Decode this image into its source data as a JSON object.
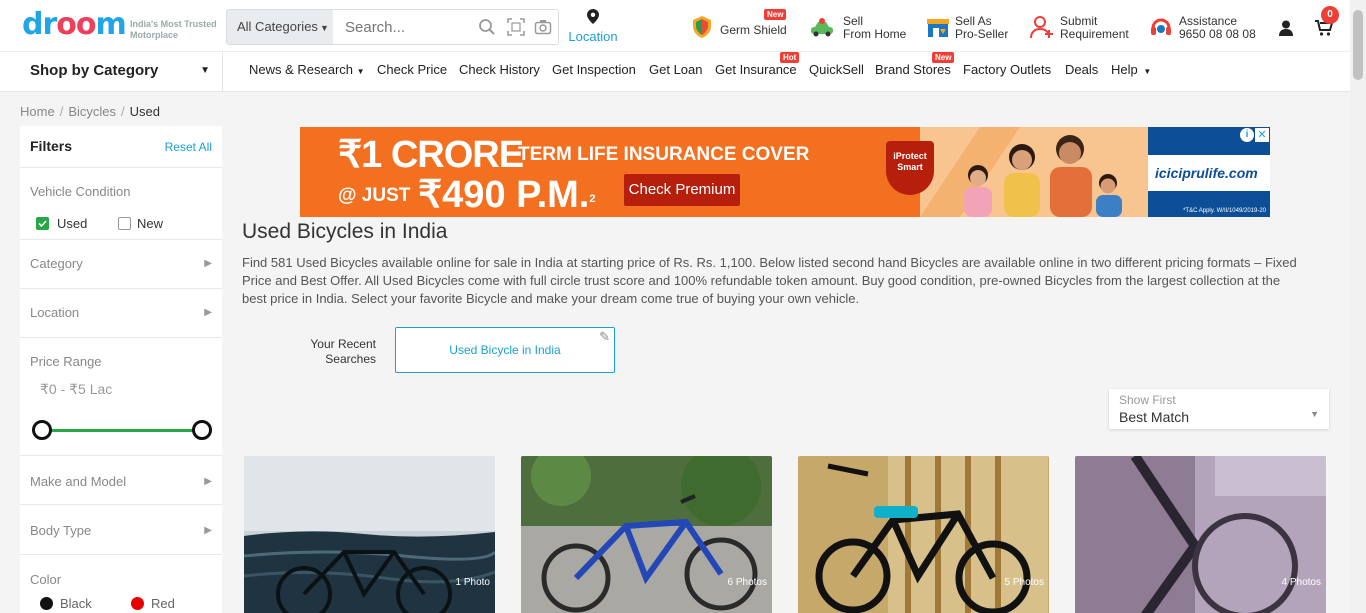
{
  "header": {
    "logo": {
      "p1": "dr",
      "p2": "oo",
      "p3": "m"
    },
    "tagline": [
      "India's Most Trusted",
      "Motorplace"
    ],
    "category_select": "All Categories",
    "search_placeholder": "Search...",
    "location_label": "Location",
    "quick_links": [
      {
        "l1": "Germ Shield",
        "l2": "",
        "badge": "New"
      },
      {
        "l1": "Sell",
        "l2": "From Home",
        "badge": ""
      },
      {
        "l1": "Sell As",
        "l2": "Pro-Seller",
        "badge": ""
      },
      {
        "l1": "Submit",
        "l2": "Requirement",
        "badge": ""
      },
      {
        "l1": "Assistance",
        "l2": "9650 08 08 08",
        "badge": ""
      }
    ],
    "cart_count": "0"
  },
  "nav": {
    "shop_by_category": "Shop by Category",
    "links": [
      {
        "label": "News & Research",
        "badge": ""
      },
      {
        "label": "Check Price",
        "badge": ""
      },
      {
        "label": "Check History",
        "badge": ""
      },
      {
        "label": "Get Inspection",
        "badge": ""
      },
      {
        "label": "Get Loan",
        "badge": ""
      },
      {
        "label": "Get Insurance",
        "badge": "Hot"
      },
      {
        "label": "QuickSell",
        "badge": ""
      },
      {
        "label": "Brand Stores",
        "badge": "New"
      },
      {
        "label": "Factory Outlets",
        "badge": ""
      },
      {
        "label": "Deals",
        "badge": ""
      },
      {
        "label": "Help",
        "badge": ""
      }
    ]
  },
  "breadcrumb": [
    "Home",
    "Bicycles",
    "Used"
  ],
  "filters": {
    "title": "Filters",
    "reset": "Reset All",
    "vehicle_condition": "Vehicle Condition",
    "used": "Used",
    "new": "New",
    "category": "Category",
    "location": "Location",
    "price_range": "Price Range",
    "price_value": "₹0 - ₹5 Lac",
    "price_min_fraction": 0,
    "price_max_fraction": 1,
    "make_model": "Make and Model",
    "body_type": "Body Type",
    "color": "Color",
    "colors": [
      {
        "name": "Black",
        "hex": "#111111"
      },
      {
        "name": "Red",
        "hex": "#e60000"
      }
    ]
  },
  "ad": {
    "line1": "₹1 CRORE",
    "line1_suffix": "TERM LIFE INSURANCE COVER",
    "line2_prefix": "@ JUST",
    "line2": "₹490 P.M.",
    "superscript": "2",
    "cta": "Check Premium",
    "shield": "iProtect Smart",
    "url": "iciciprulife.com",
    "tnc": "*T&C Apply. W/II/1049/2019-20"
  },
  "main": {
    "title": "Used Bicycles in India",
    "description": "Find 581 Used Bicycles available online for sale in India at starting price of Rs. Rs. 1,100. Below listed second hand Bicycles are available online in two different pricing formats – Fixed Price and Best Offer. All Used Bicycles come with full circle trust score and 100% refundable token amount. Buy good condition, pre-owned Bicycles from the largest collection at the best price in India. Select your favorite Bicycle and make your dream come true of buying your own vehicle.",
    "recent_label_1": "Your Recent",
    "recent_label_2": "Searches",
    "recent_search": "Used Bicycle in India",
    "sort_label": "Show First",
    "sort_value": "Best Match",
    "cards": [
      {
        "photos": "1 Photo"
      },
      {
        "photos": "6 Photos"
      },
      {
        "photos": "5 Photos"
      },
      {
        "photos": "4 Photos"
      }
    ]
  }
}
